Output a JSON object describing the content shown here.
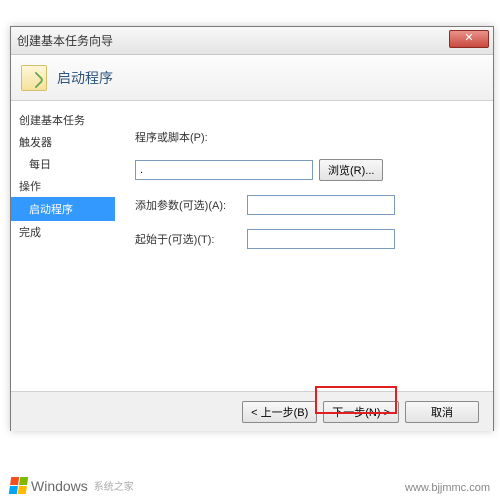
{
  "window": {
    "title": "创建基本任务向导",
    "close": "✕"
  },
  "header": {
    "title": "启动程序"
  },
  "sidebar": {
    "item_create": "创建基本任务",
    "item_trigger": "触发器",
    "item_daily": "每日",
    "item_action": "操作",
    "item_startprog": "启动程序",
    "item_finish": "完成"
  },
  "form": {
    "script_label": "程序或脚本(P):",
    "script_value": ".",
    "browse_label": "浏览(R)...",
    "args_label": "添加参数(可选)(A):",
    "args_value": "",
    "startin_label": "起始于(可选)(T):",
    "startin_value": ""
  },
  "footer": {
    "back": "< 上一步(B)",
    "next": "下一步(N) >",
    "cancel": "取消"
  },
  "watermark": {
    "brand": "Windows",
    "brand_sub": "系统之家",
    "url": "www.bjjmmc.com"
  }
}
